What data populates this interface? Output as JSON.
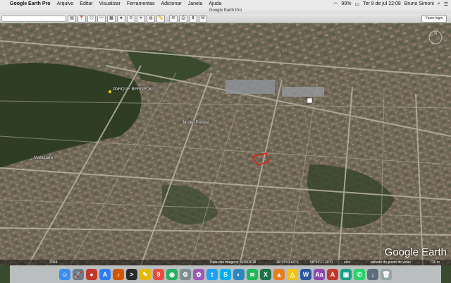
{
  "menubar": {
    "apple_glyph": "",
    "items": [
      "Google Earth Pro",
      "Arquivo",
      "Editar",
      "Visualizar",
      "Ferramentas",
      "Adicionar",
      "Janela",
      "Ajuda"
    ],
    "battery": "99%",
    "datetime": "Ter 9 de jul  22:08",
    "user": "Bruno Simoni"
  },
  "window": {
    "title": "Google Earth Pro"
  },
  "toolbar": {
    "login_label": "Fazer login"
  },
  "map": {
    "labels": {
      "parque": "PARQUE BERNECK",
      "jardim": "Jardim Paraná",
      "marajoara": "Marajoara"
    },
    "logo": "Google Earth"
  },
  "status": {
    "date": "Data das imagens: 5/29/2018",
    "lat": "16°39'02.64\"S",
    "lon": "58°09'17.20\"O",
    "elev": "elev",
    "altitude_label": "altitude do ponto de visão",
    "altitude": "776 m",
    "year": "2004"
  },
  "dock": {
    "icons": [
      {
        "name": "finder-icon",
        "color": "#3b8df0",
        "glyph": "☺"
      },
      {
        "name": "launchpad-icon",
        "color": "#6b7b8c",
        "glyph": "🚀"
      },
      {
        "name": "photo-booth-icon",
        "color": "#c0392b",
        "glyph": "●"
      },
      {
        "name": "app-store-icon",
        "color": "#2d7cf6",
        "glyph": "A"
      },
      {
        "name": "music-icon",
        "color": "#d35400",
        "glyph": "♪"
      },
      {
        "name": "terminal-icon",
        "color": "#2b2b2b",
        "glyph": ">"
      },
      {
        "name": "notes-icon",
        "color": "#e6b800",
        "glyph": "✎"
      },
      {
        "name": "calendar-icon",
        "color": "#e74c3c",
        "glyph": "9"
      },
      {
        "name": "chrome-icon",
        "color": "#27ae60",
        "glyph": "◉"
      },
      {
        "name": "settings-icon",
        "color": "#7f8c8d",
        "glyph": "⚙"
      },
      {
        "name": "photos-icon",
        "color": "#9b59b6",
        "glyph": "✿"
      },
      {
        "name": "twitter-icon",
        "color": "#1da1f2",
        "glyph": "t"
      },
      {
        "name": "skype-icon",
        "color": "#00aff0",
        "glyph": "S"
      },
      {
        "name": "google-earth-icon",
        "color": "#2e86c1",
        "glyph": "◐"
      },
      {
        "name": "spotify-icon",
        "color": "#1db954",
        "glyph": "≋"
      },
      {
        "name": "excel-icon",
        "color": "#1e7145",
        "glyph": "X"
      },
      {
        "name": "vlc-icon",
        "color": "#e67e22",
        "glyph": "▲"
      },
      {
        "name": "google-drive-icon",
        "color": "#f1c40f",
        "glyph": "△"
      },
      {
        "name": "word-icon",
        "color": "#2b579a",
        "glyph": "W"
      },
      {
        "name": "dictionary-icon",
        "color": "#8e44ad",
        "glyph": "Aa"
      },
      {
        "name": "acrobat-icon",
        "color": "#c0392b",
        "glyph": "A"
      },
      {
        "name": "preview-icon",
        "color": "#16a085",
        "glyph": "▣"
      },
      {
        "name": "whatsapp-icon",
        "color": "#25d366",
        "glyph": "✆"
      },
      {
        "name": "downloads-icon",
        "color": "#5d6d7e",
        "glyph": "↓"
      },
      {
        "name": "trash-icon",
        "color": "#95a5a6",
        "glyph": "🗑"
      }
    ]
  }
}
